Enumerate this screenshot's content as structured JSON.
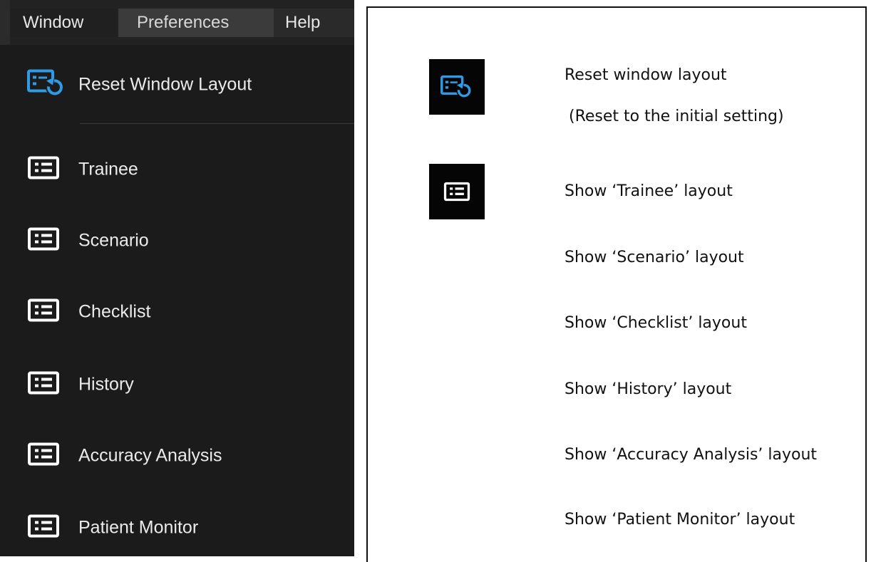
{
  "menubar": {
    "items": [
      {
        "label": "Window"
      },
      {
        "label": "Preferences"
      },
      {
        "label": "Help"
      }
    ]
  },
  "menu": {
    "items": [
      {
        "label": "Reset Window Layout",
        "icon": "reset-layout-icon"
      },
      {
        "label": "Trainee",
        "icon": "panel-list-icon"
      },
      {
        "label": "Scenario",
        "icon": "panel-list-icon"
      },
      {
        "label": "Checklist",
        "icon": "panel-list-icon"
      },
      {
        "label": "History",
        "icon": "panel-list-icon"
      },
      {
        "label": "Accuracy Analysis",
        "icon": "panel-list-icon"
      },
      {
        "label": "Patient Monitor",
        "icon": "panel-list-icon"
      }
    ]
  },
  "legend": {
    "reset_line1": "Reset window layout",
    "reset_line2": "(Reset to the initial setting)",
    "rows": [
      "Show ‘Trainee’ layout",
      "Show ‘Scenario’ layout",
      "Show ‘Checklist’ layout",
      "Show ‘History’ layout",
      "Show ‘Accuracy Analysis’ layout",
      "Show ‘Patient Monitor’ layout"
    ]
  },
  "colors": {
    "menu_bg": "#1b1b1b",
    "menu_text": "#ebebeb",
    "accent_blue": "#2f9be6"
  }
}
